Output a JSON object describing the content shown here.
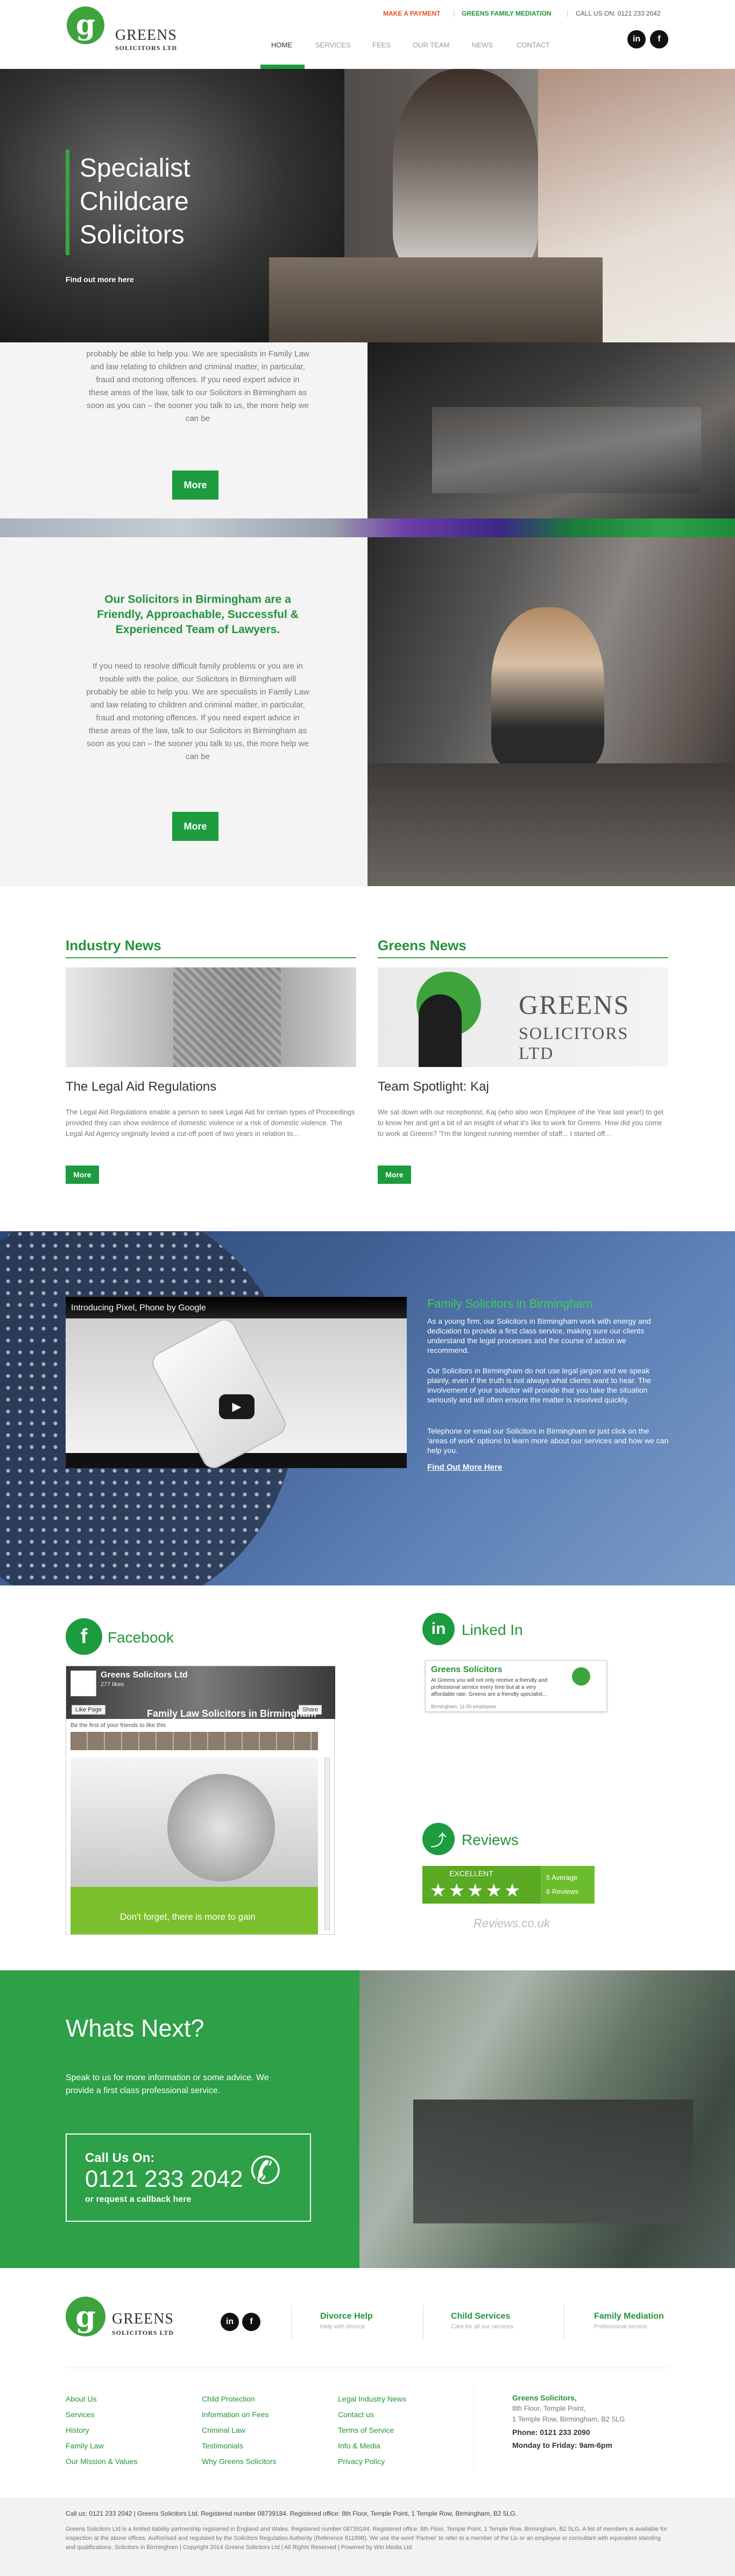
{
  "header": {
    "logo_letter": "g",
    "logo_name": "GREENS",
    "logo_sub": "SOLICITORS LTD",
    "make_payment": "MAKE A PAYMENT",
    "mediation": "GREENS FAMILY MEDIATION",
    "call_us": "CALL US ON: 0121 233 2042",
    "nav": [
      "HOME",
      "SERVICES",
      "FEES",
      "OUR TEAM",
      "NEWS",
      "CONTACT"
    ],
    "linkedin": "in",
    "facebook": "f"
  },
  "hero": {
    "title_lines": [
      "Specialist",
      "Childcare",
      "Solicitors"
    ],
    "link": "Find out more here"
  },
  "intro_partial": {
    "text": "probably be able to help you. We are specialists in Family Law and law relating to children and criminal matter, in particular, fraud and motoring offences. If you need expert advice in these areas of the law, talk to our Solicitors in Birmingham as soon as you can – the sooner you talk to us, the more help we can be",
    "button": "More"
  },
  "intro": {
    "heading": "Our Solicitors in Birmingham are a Friendly, Approachable, Successful & Experienced Team of Lawyers.",
    "text": "If you need to resolve difficult family problems or you are in trouble with the police, our Solicitors in Birmingham will probably be able to help you. We are specialists in Family Law and law relating to children and criminal matter, in particular, fraud and motoring offences. If you need expert advice in these areas of the law, talk to our Solicitors in Birmingham as soon as you can – the sooner you talk to us, the more help we can be",
    "button": "More"
  },
  "news": {
    "industry_title": "Industry News",
    "greens_title": "Greens News",
    "articles": [
      {
        "title": "The Legal Aid Regulations",
        "text": "The Legal Aid Regulations enable a person to seek Legal Aid for certain types of Proceedings provided they can show evidence of domestic violence or a risk of domestic violence. The Legal Aid Agency originally levied a cut-off point of two years in relation to...",
        "button": "More"
      },
      {
        "title": "Team Spotlight: Kaj",
        "text": "We sat down with our receptionist, Kaj (who also won Employee of the Year last year!) to get to know her and get a bit of an insight of what it's like to work for Greens. How did you come to work at Greens? \"I'm the longest running member of staff... I started off...",
        "button": "More"
      }
    ],
    "banner_name": "GREENS",
    "banner_sub": "SOLICITORS LTD"
  },
  "video_section": {
    "video_title": "Introducing Pixel, Phone by Google",
    "heading": "Family Solicitors in Birmingham",
    "p1": "As a young firm, our Solicitors in Birmingham work with energy and dedication to provide a first class service, making sure our clients understand the legal processes and the course of action we recommend.",
    "p2": "Our Solicitors in Birmingham do not use legal jargon and we speak plainly, even if the truth is not always what clients want to hear. The involvement of your solicitor will provide that you take the situation seriously and will often ensure the matter is resolved quickly.",
    "p3": "Telephone or email our Solicitors in Birmingham or just click on the 'areas of work' options to learn more about our services and how we can help you.",
    "link": "Find Out More Here"
  },
  "facebook": {
    "title": "Facebook",
    "icon": "f",
    "page_name": "Greens Solicitors Ltd",
    "likes": "277 likes",
    "like_page": "Like Page",
    "share": "Share",
    "be_first": "Be the first of your friends to like this",
    "post_title": "Family Law Solicitors in Birmingham",
    "post_banner": "Don't forget, there is more to gain"
  },
  "linkedin": {
    "title": "Linked In",
    "icon": "in",
    "card_title": "Greens Solicitors",
    "card_text": "At Greens you will not only receive a friendly and professional service every time but at a very affordable rate. Greens are a friendly specialist...",
    "card_meta": "Birmingham; 11-50 employees"
  },
  "reviews": {
    "title": "Reviews",
    "icon": "share-icon",
    "excellent": "EXCELLENT",
    "stars": "★★★★★",
    "average": "5 Average",
    "count": "6 Reviews",
    "brand": "Reviews.co.uk"
  },
  "whats_next": {
    "title": "Whats Next?",
    "text": "Speak to us for more information or some advice. We provide a first class professional service.",
    "call_label": "Call Us On:",
    "phone": "0121 233 2042",
    "callback": "or request a callback here"
  },
  "footer": {
    "logo_name": "GREENS",
    "logo_sub": "SOLICITORS LTD",
    "services": [
      {
        "title": "Divorce Help",
        "sub": "Help with divorce"
      },
      {
        "title": "Child Services",
        "sub": "Care for all our services"
      },
      {
        "title": "Family Mediation",
        "sub": "Professional service"
      }
    ],
    "col1": [
      "About Us",
      "Services",
      "History",
      "Family Law",
      "Our Mission & Values"
    ],
    "col2": [
      "Child Protection",
      "Information on Fees",
      "Criminal Law",
      "Testimonials",
      "Why Greens Solicitors"
    ],
    "col3": [
      "Legal Industry News",
      "Contact us",
      "Terms of Service",
      "Info & Media",
      "Privacy Policy"
    ],
    "address_title": "Greens Solicitors,",
    "address_lines": [
      "8th Floor, Temple Point,",
      "1 Temple Row, Birmingham, B2 5LG"
    ],
    "phone": "Phone: 0121 233 2090",
    "hours": "Monday to Friday: 9am-6pm",
    "bottom_line": "Call us: 0121 233 2042 | Greens Solicitors Ltd. Registered number 08739184. Registered office: 8th Floor, Temple Point, 1 Temple Row, Birmingham, B2 5LG.",
    "legal": "Greens Solicitors Ltd is a limited liability partnership registered in England and Wales. Registered number 08739184. Registered office: 8th Floor, Temple Point, 1 Temple Row, Birmingham, B2 5LG. A list of members is available for inspection at the above offices. Authorised and regulated by the Solicitors Regulation Authority (Reference 611998). We use the word 'Partner' to refer to a member of the Llc or an employee or consultant with equivalent standing and qualifications. Solicitors in Birmingham | Copyright 2014 Greens Solicitors Ltd | All Rights Reserved | Powered by Win Media Ltd"
  }
}
